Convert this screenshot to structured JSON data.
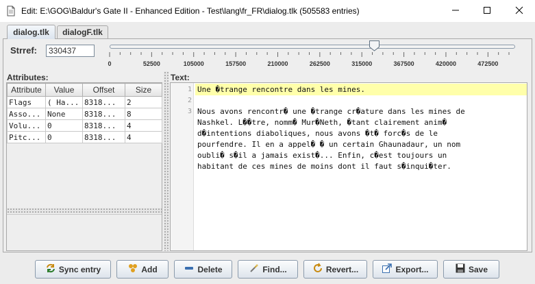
{
  "window": {
    "title": "Edit: E:\\GOG\\Baldur's Gate II - Enhanced Edition - Test\\lang\\fr_FR\\dialog.tlk (505583 entries)",
    "controls": [
      "minimize-icon",
      "maximize-icon",
      "close-icon"
    ]
  },
  "tabs": [
    {
      "label": "dialog.tlk",
      "active": true
    },
    {
      "label": "dialogF.tlk",
      "active": false
    }
  ],
  "strref": {
    "label": "Strref:",
    "value": "330437",
    "slider_value": 330437,
    "slider_max": 505582,
    "ticks": [
      "0",
      "52500",
      "105000",
      "157500",
      "210000",
      "262500",
      "315000",
      "367500",
      "420000",
      "472500"
    ]
  },
  "attributes": {
    "label": "Attributes:",
    "columns": [
      "Attribute",
      "Value",
      "Offset",
      "Size"
    ],
    "rows": [
      [
        "Flags",
        "( Ha...",
        "8318...",
        "2"
      ],
      [
        "Asso...",
        "None",
        "8318...",
        "8"
      ],
      [
        "Volu...",
        "0",
        "8318...",
        "4"
      ],
      [
        "Pitc...",
        "0",
        "8318...",
        "4"
      ]
    ]
  },
  "text": {
    "label": "Text:",
    "line_numbers": [
      "1",
      "2",
      "3"
    ],
    "lines": [
      "Une �trange rencontre dans les mines.",
      "",
      "Nous avons rencontr� une �trange cr�ature dans les mines de",
      "Nashkel. L��tre, nomm� Mur�Neth, �tant clairement anim�",
      "d�intentions diaboliques, nous avons �t� forc�s de le",
      "pourfendre. Il en a appel� � un certain Ghaunadaur, un nom",
      "oubli� s�il a jamais exist�... Enfin, c�est toujours un",
      "habitant de ces mines de moins dont il faut s�inqui�ter."
    ]
  },
  "buttons": [
    {
      "label": "Sync entry",
      "icon": "sync-icon"
    },
    {
      "label": "Add",
      "icon": "add-icon"
    },
    {
      "label": "Delete",
      "icon": "delete-icon"
    },
    {
      "label": "Find...",
      "icon": "find-icon"
    },
    {
      "label": "Revert...",
      "icon": "revert-icon"
    },
    {
      "label": "Export...",
      "icon": "export-icon"
    },
    {
      "label": "Save",
      "icon": "save-icon"
    }
  ]
}
